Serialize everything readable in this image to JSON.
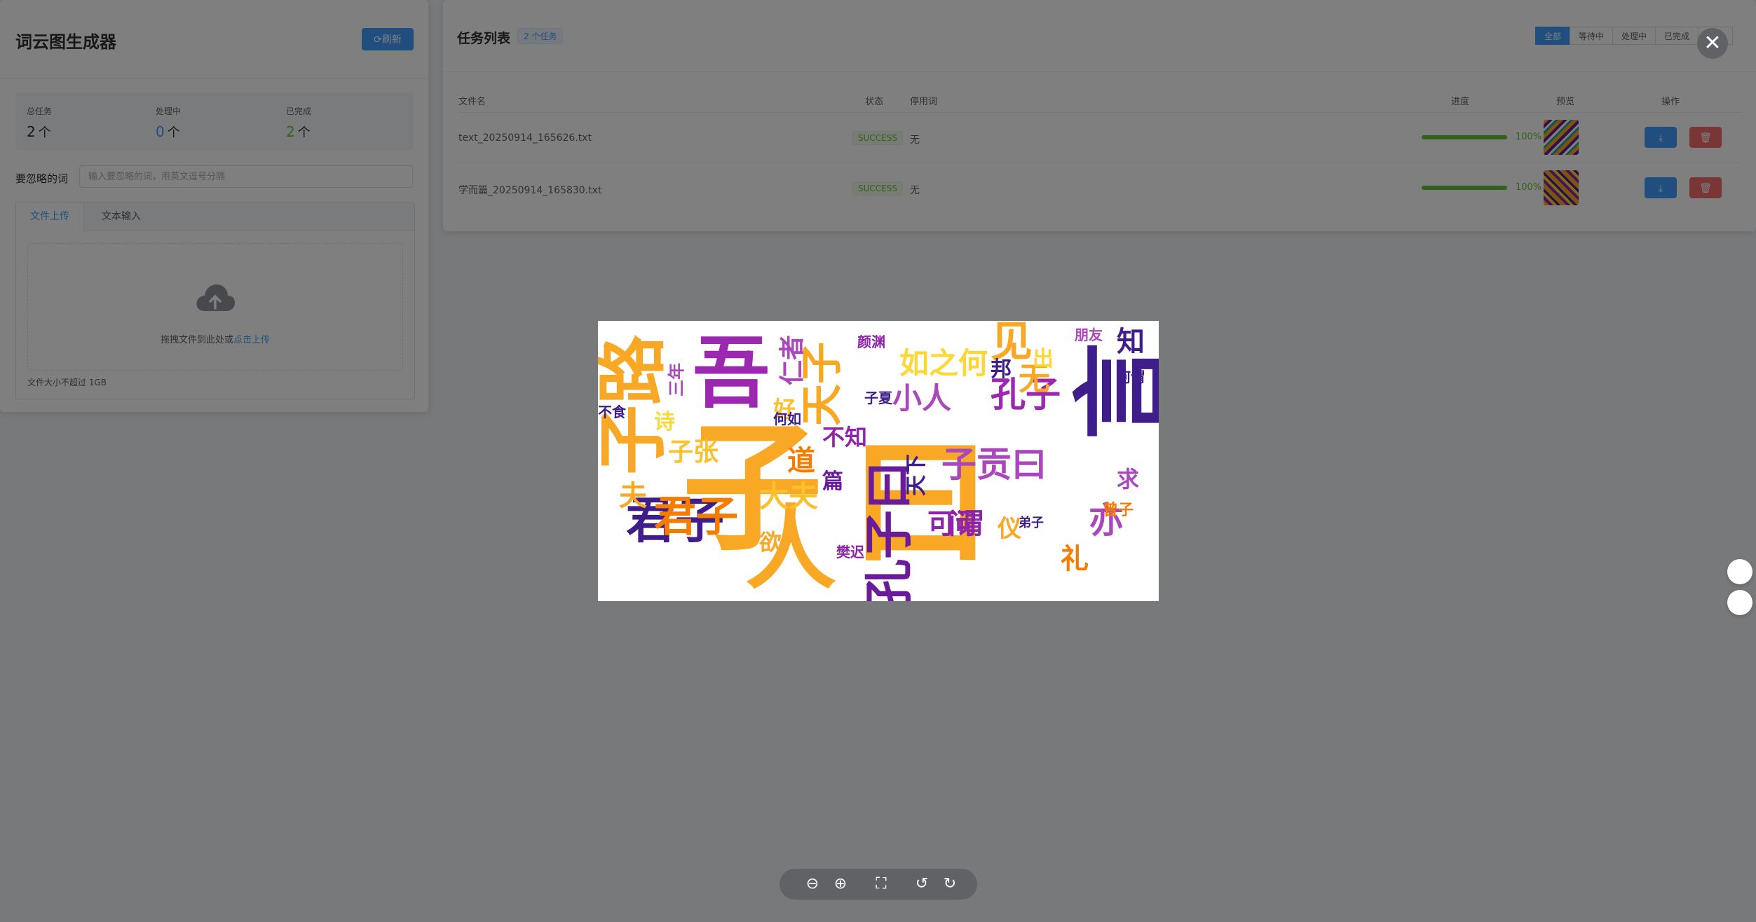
{
  "left_panel": {
    "app_title": "词云图生成器",
    "refresh_label": "⟳刷新",
    "stats": [
      {
        "label": "总任务",
        "value": "2",
        "unit": "个"
      },
      {
        "label": "处理中",
        "value": "0",
        "unit": "个"
      },
      {
        "label": "已完成",
        "value": "2",
        "unit": "个"
      }
    ],
    "ignore_label": "要忽略的词",
    "ignore_placeholder": "输入要忽略的词，用英文逗号分隔",
    "tabs": [
      "文件上传",
      "文本输入"
    ],
    "upload_text": "拖拽文件到此处或",
    "upload_link": "点击上传",
    "upload_tip": "文件大小不超过 1GB"
  },
  "right_panel": {
    "title": "任务列表",
    "task_count_badge": "2 个任务",
    "filters": [
      "全部",
      "等待中",
      "处理中",
      "已完成",
      "失败"
    ],
    "table": {
      "headers": [
        "文件名",
        "状态",
        "停用词",
        "进度",
        "预览",
        "操作"
      ],
      "rows": [
        {
          "filename": "text_20250914_165626.txt",
          "status": "SUCCESS",
          "stopwords": "无",
          "progress": 1.0,
          "progress_label": "100%"
        },
        {
          "filename": "学而篇_20250914_165830.txt",
          "status": "SUCCESS",
          "stopwords": "无",
          "progress": 1.0,
          "progress_label": "100%"
        }
      ]
    }
  },
  "viewer": {
    "close_symbol": "✕",
    "tools": [
      "zoom-out-icon",
      "zoom-in-icon",
      "fullscreen-icon",
      "rotate-left-icon",
      "rotate-right-icon"
    ],
    "wordcloud": [
      {
        "t": "子",
        "color": "#f9a825"
      },
      {
        "t": "曰",
        "color": "#f9a825"
      },
      {
        "t": "人",
        "color": "#f9a825"
      },
      {
        "t": "君子",
        "color": "#3f1e8c"
      },
      {
        "t": "吾",
        "color": "#9c27b0"
      },
      {
        "t": "子路",
        "color": "#f9a825"
      },
      {
        "t": "言",
        "color": "#3f1e8c"
      },
      {
        "t": "孔子曰",
        "color": "#6a1b9a"
      },
      {
        "t": "子贡曰",
        "color": "#ab47bc"
      },
      {
        "t": "天子",
        "color": "#f9a825"
      },
      {
        "t": "如之何",
        "color": "#fdd835"
      },
      {
        "t": "小人",
        "color": "#ab47bc"
      },
      {
        "t": "见",
        "color": "#f9a825"
      },
      {
        "t": "孔子",
        "color": "#9c27b0"
      },
      {
        "t": "君子",
        "color": "#f57c00"
      },
      {
        "t": "可谓",
        "color": "#8e24aa"
      },
      {
        "t": "大夫",
        "color": "#fbc02d"
      },
      {
        "t": "知",
        "color": "#3f1e8c"
      },
      {
        "t": "无",
        "color": "#f9a825"
      },
      {
        "t": "仁者",
        "color": "#ab47bc"
      },
      {
        "t": "道",
        "color": "#f57c00"
      },
      {
        "t": "问",
        "color": "#8e24aa"
      },
      {
        "t": "亦",
        "color": "#ab47bc"
      },
      {
        "t": "礼",
        "color": "#f57c00"
      },
      {
        "t": "好",
        "color": "#fbc02d"
      },
      {
        "t": "邦",
        "color": "#3f1e8c"
      },
      {
        "t": "篇",
        "color": "#6a1b9a"
      },
      {
        "t": "夫",
        "color": "#f9a825"
      },
      {
        "t": "不知",
        "color": "#8e24aa"
      },
      {
        "t": "子张",
        "color": "#fbc02d"
      },
      {
        "t": "诗",
        "color": "#fdd835"
      },
      {
        "t": "欲",
        "color": "#f9a825"
      },
      {
        "t": "求",
        "color": "#ab47bc"
      },
      {
        "t": "出",
        "color": "#fdd835"
      },
      {
        "t": "朋友",
        "color": "#ab47bc"
      },
      {
        "t": "何谓",
        "color": "#3f1e8c"
      },
      {
        "t": "弟子",
        "color": "#3f1e8c"
      },
      {
        "t": "仪",
        "color": "#f9a825"
      },
      {
        "t": "天下",
        "color": "#3f1e8c"
      },
      {
        "t": "樊迟",
        "color": "#8e24aa"
      },
      {
        "t": "颜渊",
        "color": "#8e24aa"
      },
      {
        "t": "子夏",
        "color": "#3f1e8c"
      },
      {
        "t": "曾子",
        "color": "#f57c00"
      },
      {
        "t": "三年",
        "color": "#ab47bc"
      },
      {
        "t": "何如",
        "color": "#3f1e8c"
      },
      {
        "t": "不食",
        "color": "#3f1e8c"
      }
    ]
  },
  "colors": {
    "primary": "#409eff",
    "success": "#67c23a",
    "danger": "#f56c6c",
    "overlay": "rgba(0,0,0,0.5)"
  }
}
